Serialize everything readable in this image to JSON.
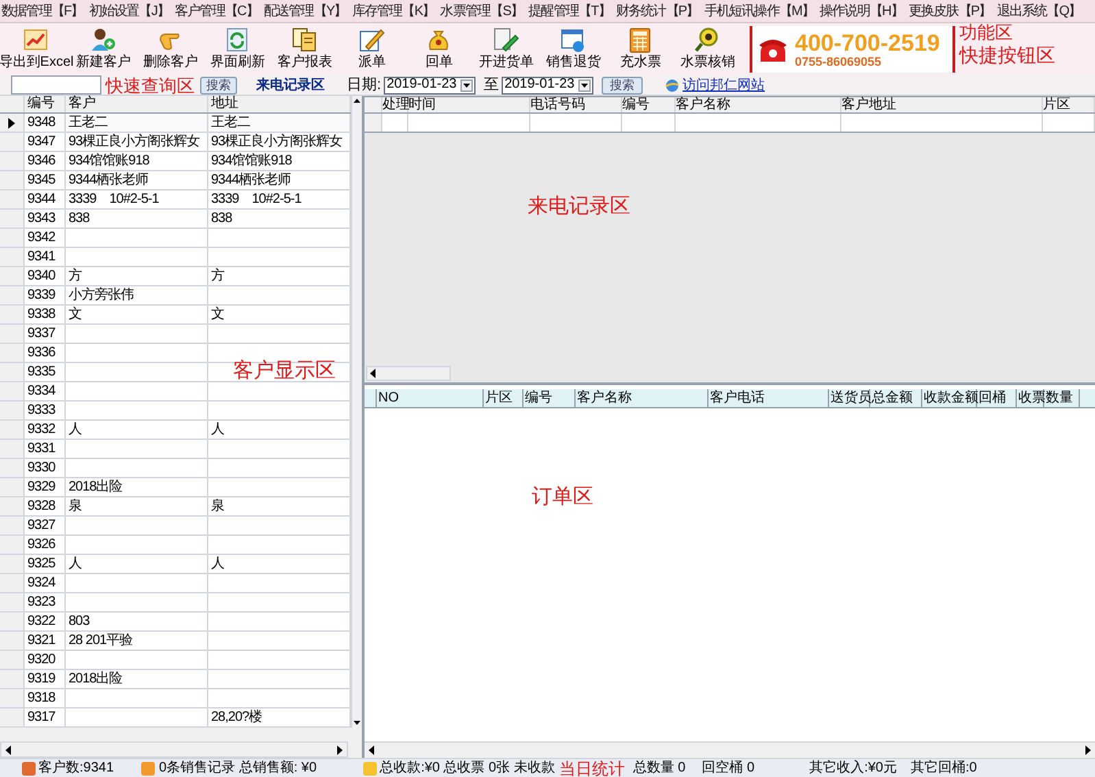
{
  "menu": [
    "数据管理【F】",
    "初始设置【J】",
    "客户管理【C】",
    "配送管理【Y】",
    "库存管理【K】",
    "水票管理【S】",
    "提醒管理【T】",
    "财务统计【P】",
    "手机短讯操作【M】",
    "操作说明【H】",
    "更换皮肤【P】",
    "退出系统【Q】"
  ],
  "toolbar": [
    "导出到Excel",
    "新建客户",
    "删除客户",
    "界面刷新",
    "客户报表",
    "派单",
    "回单",
    "开进货单",
    "销售退货",
    "充水票",
    "水票核销"
  ],
  "hotline": {
    "main": "400-700-2519",
    "sub": "0755-86069055"
  },
  "search_bar": {
    "search_button": "搜索",
    "call_log_label": "来电记录区",
    "date_label": "日期:",
    "date_from": "2019-01-23",
    "to_label": "至",
    "date_to": "2019-01-23",
    "search_button_2": "搜索",
    "website_link": "访问邦仁网站"
  },
  "customer_table": {
    "columns": [
      "编号",
      "客户",
      "地址"
    ],
    "rows": [
      {
        "id": "9348",
        "customer": "王老二",
        "address": "王老二",
        "selected": true
      },
      {
        "id": "9347",
        "customer": "93棵正良小方阁张辉女",
        "address": "93棵正良小方阁张辉女",
        "selected": false
      },
      {
        "id": "9346",
        "customer": "934馆馆账918",
        "address": "934馆馆账918",
        "selected": false
      },
      {
        "id": "9345",
        "customer": "9344栖张老师",
        "address": "9344栖张老师",
        "selected": false
      },
      {
        "id": "9344",
        "customer": "3339　10#2-5-1",
        "address": "3339　10#2-5-1",
        "selected": false
      },
      {
        "id": "9343",
        "customer": "838",
        "address": "838",
        "selected": false
      },
      {
        "id": "9342",
        "selected": false
      },
      {
        "id": "9341",
        "selected": false
      },
      {
        "id": "9340",
        "customer": "方",
        "address": "方",
        "selected": false
      },
      {
        "id": "9339",
        "customer": "小方旁张伟",
        "selected": false
      },
      {
        "id": "9338",
        "customer": "文",
        "address": "文",
        "selected": false
      },
      {
        "id": "9337",
        "selected": false
      },
      {
        "id": "9336",
        "selected": false
      },
      {
        "id": "9335",
        "selected": false
      },
      {
        "id": "9334",
        "selected": false
      },
      {
        "id": "9333",
        "selected": false
      },
      {
        "id": "9332",
        "customer": "人",
        "address": "人",
        "selected": false
      },
      {
        "id": "9331",
        "selected": false
      },
      {
        "id": "9330",
        "selected": false
      },
      {
        "id": "9329",
        "customer": "2018出险",
        "selected": false
      },
      {
        "id": "9328",
        "customer": "泉",
        "address": "泉",
        "selected": false
      },
      {
        "id": "9327",
        "selected": false
      },
      {
        "id": "9326",
        "selected": false
      },
      {
        "id": "9325",
        "customer": "人",
        "address": "人",
        "selected": false
      },
      {
        "id": "9324",
        "selected": false
      },
      {
        "id": "9323",
        "selected": false
      },
      {
        "id": "9322",
        "customer": "803",
        "selected": false
      },
      {
        "id": "9321",
        "customer": "28 201平验",
        "selected": false
      },
      {
        "id": "9320",
        "selected": false
      },
      {
        "id": "9319",
        "customer": "2018出险",
        "selected": false
      },
      {
        "id": "9318",
        "selected": false
      },
      {
        "id": "9317",
        "address": "28,20?楼",
        "selected": false
      }
    ]
  },
  "call_table": {
    "columns": [
      "处理",
      "时间",
      "电话号码",
      "编号",
      "客户名称",
      "客户地址",
      "片区"
    ]
  },
  "order_table": {
    "columns": [
      "NO",
      "片区",
      "编号",
      "客户名称",
      "客户电话",
      "送货员",
      "总金额",
      "收款金额",
      "回桶",
      "收票",
      "数量"
    ]
  },
  "status_bar": {
    "customer_count": "客户数:9341",
    "sales": "0条销售记录 总销售额: ¥0",
    "payments": "总收款:¥0 总收票 0张 未收款",
    "total_quantity": "总数量 0",
    "empty_buckets": "回空桶 0",
    "other_income": "其它收入:¥0元",
    "other_buckets": "其它回桶:0"
  },
  "annotations": [
    "功能区",
    "快速查询区",
    "客户显示区",
    "来电记录区",
    "订单区",
    "快捷按钮区",
    "当日统计"
  ]
}
